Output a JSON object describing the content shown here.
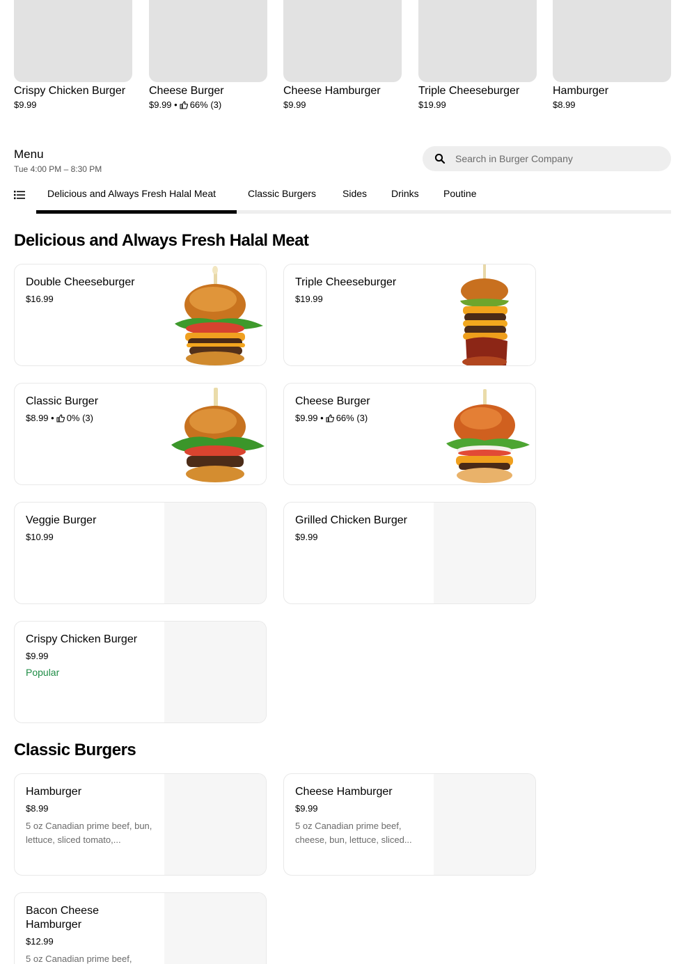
{
  "carousel": [
    {
      "title": "Crispy Chicken Burger",
      "price": "$9.99",
      "rating": ""
    },
    {
      "title": "Cheese Burger",
      "price": "$9.99 •",
      "rating": "66% (3)"
    },
    {
      "title": "Cheese Hamburger",
      "price": "$9.99",
      "rating": ""
    },
    {
      "title": "Triple Cheeseburger",
      "price": "$19.99",
      "rating": ""
    },
    {
      "title": "Hamburger",
      "price": "$8.99",
      "rating": ""
    }
  ],
  "menu": {
    "title": "Menu",
    "hours": "Tue 4:00 PM – 8:30 PM"
  },
  "search": {
    "placeholder": "Search in Burger Company"
  },
  "tabs": [
    "Delicious and Always Fresh Halal Meat",
    "Classic Burgers",
    "Sides",
    "Drinks",
    "Poutine"
  ],
  "sections": [
    {
      "title": "Delicious and Always Fresh Halal Meat",
      "items": [
        {
          "title": "Double Cheeseburger",
          "price": "$16.99",
          "rating": "",
          "badge": "",
          "desc": "",
          "image": "double-cheeseburger"
        },
        {
          "title": "Triple Cheeseburger",
          "price": "$19.99",
          "rating": "",
          "badge": "",
          "desc": "",
          "image": "triple-cheeseburger"
        },
        {
          "title": "Classic Burger",
          "price": "$8.99 •",
          "rating": "0% (3)",
          "badge": "",
          "desc": "",
          "image": "classic-burger"
        },
        {
          "title": "Cheese Burger",
          "price": "$9.99 •",
          "rating": "66% (3)",
          "badge": "",
          "desc": "",
          "image": "cheese-burger"
        },
        {
          "title": "Veggie Burger",
          "price": "$10.99",
          "rating": "",
          "badge": "",
          "desc": "",
          "image": ""
        },
        {
          "title": "Grilled Chicken Burger",
          "price": "$9.99",
          "rating": "",
          "badge": "",
          "desc": "",
          "image": ""
        },
        {
          "title": "Crispy Chicken Burger",
          "price": "$9.99",
          "rating": "",
          "badge": "Popular",
          "desc": "",
          "image": ""
        }
      ]
    },
    {
      "title": "Classic Burgers",
      "items": [
        {
          "title": "Hamburger",
          "price": "$8.99",
          "rating": "",
          "badge": "",
          "desc": "5 oz Canadian prime beef, bun, lettuce, sliced tomato,...",
          "image": ""
        },
        {
          "title": "Cheese Hamburger",
          "price": "$9.99",
          "rating": "",
          "badge": "",
          "desc": "5 oz Canadian prime beef, cheese, bun, lettuce, sliced...",
          "image": ""
        },
        {
          "title": "Bacon Cheese Hamburger",
          "price": "$12.99",
          "rating": "",
          "badge": "",
          "desc": "5 oz Canadian prime beef,",
          "image": ""
        }
      ]
    }
  ],
  "colors": {
    "popular": "#1e8c45",
    "placeholder_bg": "#e2e2e2",
    "tab_active": "#000000"
  }
}
